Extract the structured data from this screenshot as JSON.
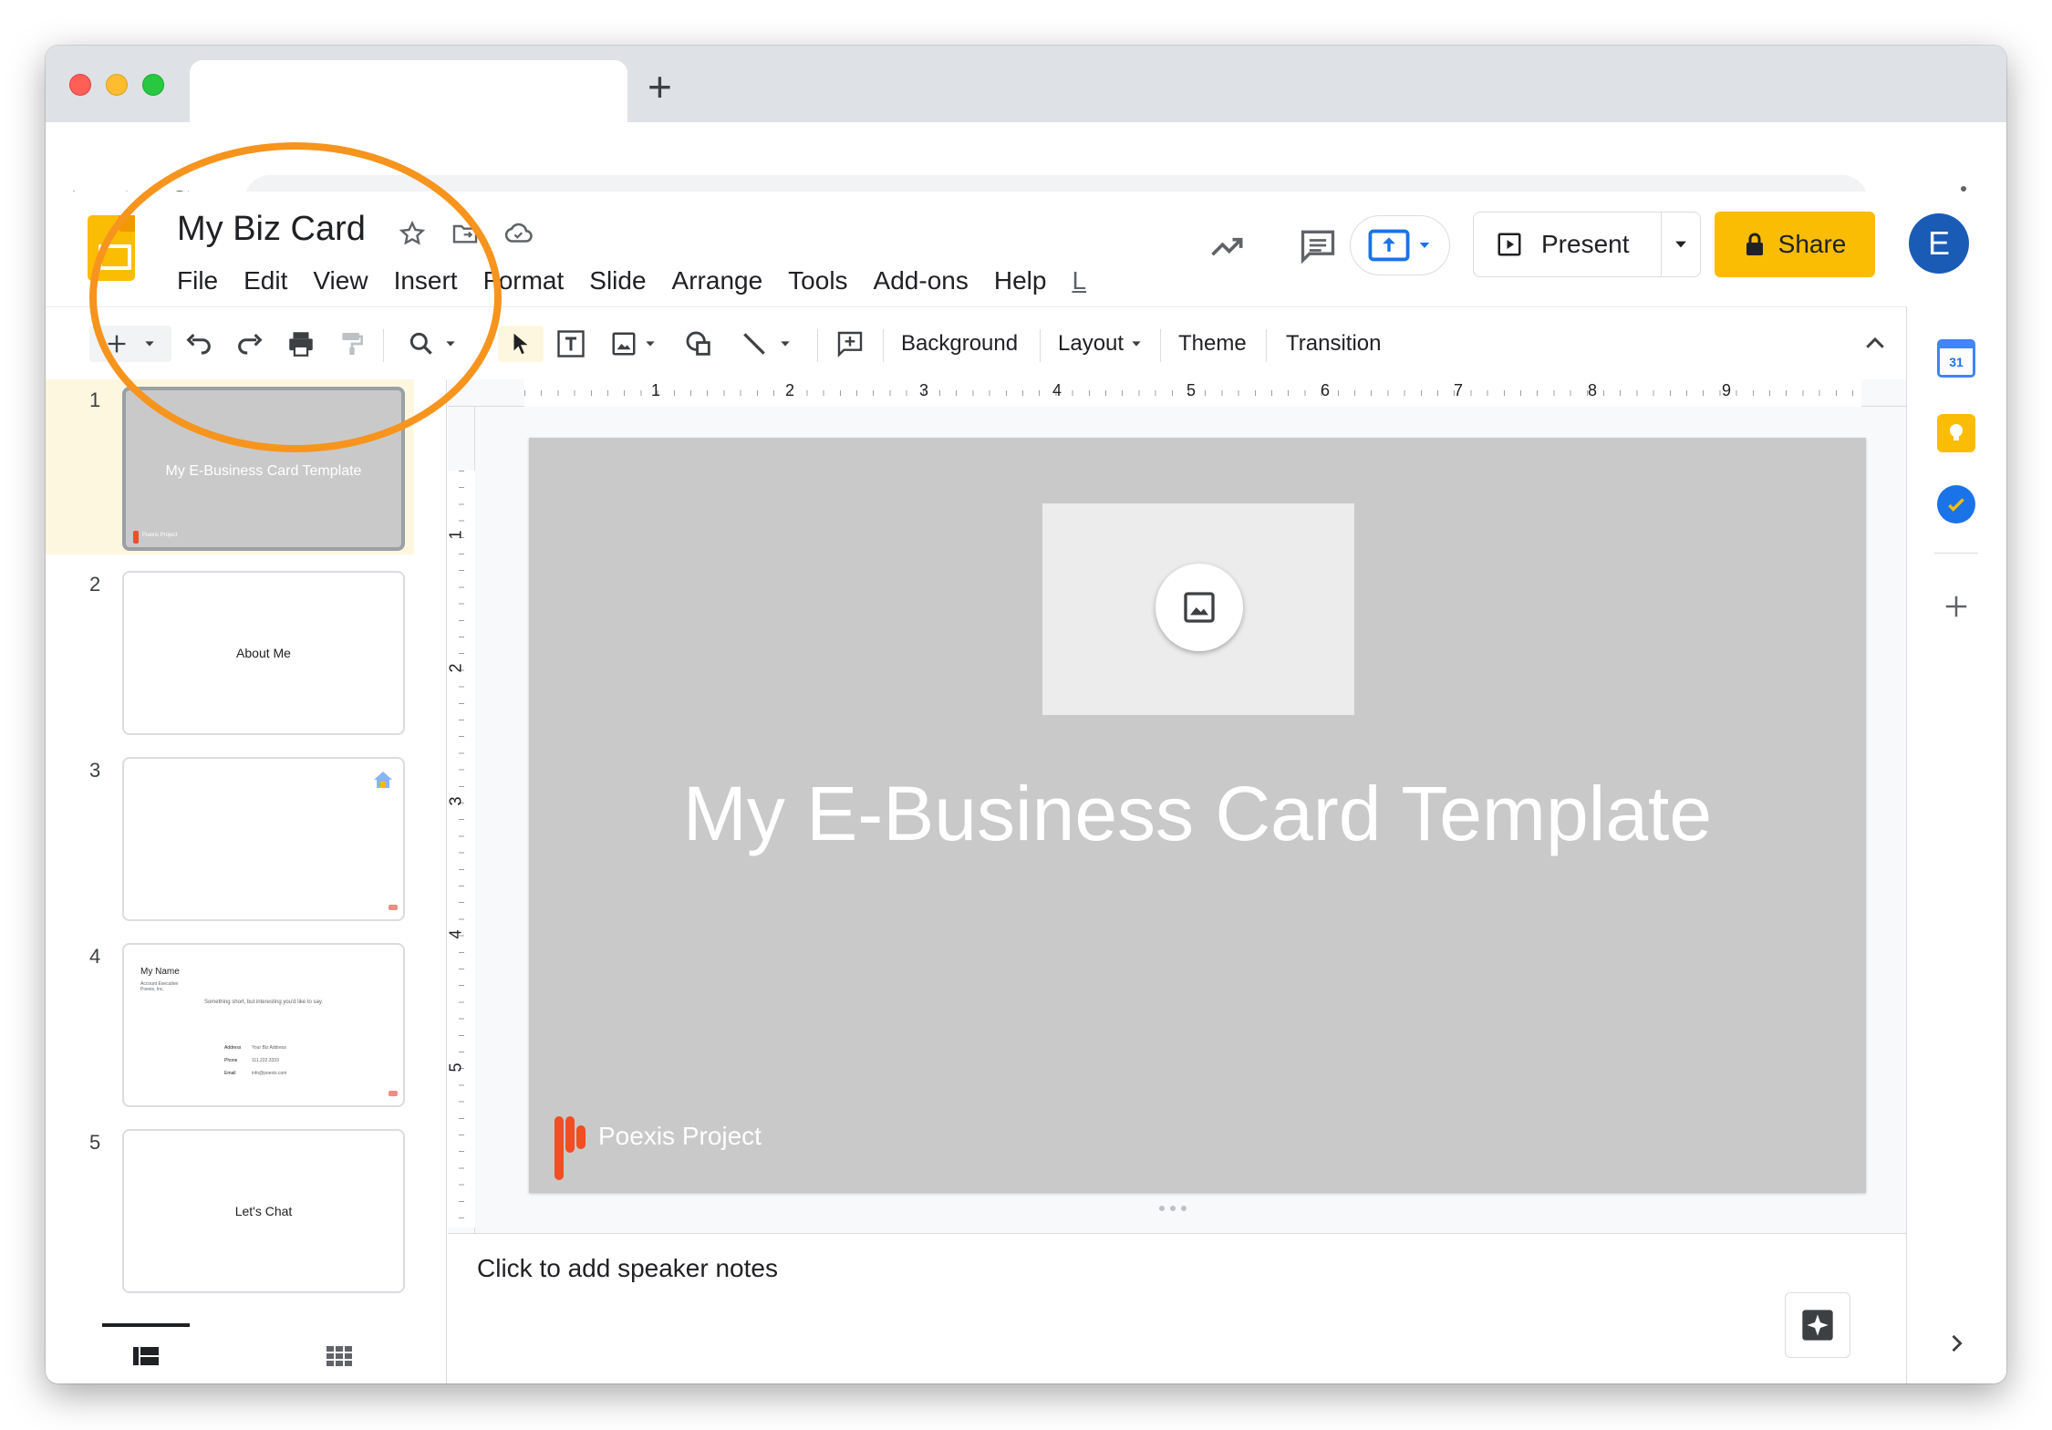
{
  "app": {
    "doc_title": "My Biz Card"
  },
  "menu": [
    {
      "label": "File"
    },
    {
      "label": "Edit"
    },
    {
      "label": "View"
    },
    {
      "label": "Insert"
    },
    {
      "label": "Format"
    },
    {
      "label": "Slide"
    },
    {
      "label": "Arrange"
    },
    {
      "label": "Tools"
    },
    {
      "label": "Add-ons"
    },
    {
      "label": "Help"
    }
  ],
  "header": {
    "present_label": "Present",
    "share_label": "Share",
    "avatar_initial": "E"
  },
  "toolbar": {
    "background_label": "Background",
    "layout_label": "Layout",
    "theme_label": "Theme",
    "transition_label": "Transition"
  },
  "ruler": {
    "h_marks": [
      "1",
      "2",
      "3",
      "4",
      "5",
      "6",
      "7",
      "8",
      "9"
    ],
    "v_marks": [
      "1",
      "2",
      "3",
      "4",
      "5"
    ]
  },
  "slides": [
    {
      "number": "1",
      "text": "My E-Business Card Template",
      "brand": "Poexis Project"
    },
    {
      "number": "2",
      "text": "About Me"
    },
    {
      "number": "3",
      "text": ""
    },
    {
      "number": "4",
      "name": "My Name",
      "role": "Account Executive",
      "company": "Poexis, Inc.",
      "tagline": "Something short, but interesting you'd like to say.",
      "rows": [
        {
          "label": "Address",
          "value": "Your Biz Address"
        },
        {
          "label": "Phone",
          "value": "111.222.3333"
        },
        {
          "label": "Email",
          "value": "info@poexis.com"
        }
      ]
    },
    {
      "number": "5",
      "text": "Let's Chat"
    }
  ],
  "canvas": {
    "title": "My E-Business Card Template",
    "brand": "Poexis Project"
  },
  "notes": {
    "placeholder": "Click to add speaker notes"
  },
  "side_panel": {
    "calendar_day": "31"
  },
  "colors": {
    "brand_yellow": "#fbbc04",
    "avatar_blue": "#1a5bb5",
    "slide_bg": "#c9c9c9",
    "annotation_orange": "#f7941d",
    "poexis_red": "#f04e23"
  }
}
